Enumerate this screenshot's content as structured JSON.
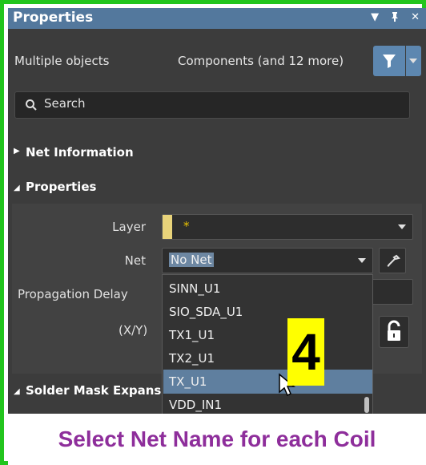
{
  "panel": {
    "title": "Properties",
    "title_icons": [
      "dropdown-arrow-icon",
      "pin-icon",
      "close-icon"
    ],
    "selection_label": "Multiple objects",
    "selection_summary": "Components (and 12 more)",
    "search_placeholder": "Search"
  },
  "sections": {
    "net_information": "Net Information",
    "properties": "Properties",
    "solder_mask": "Solder Mask Expans"
  },
  "fields": {
    "layer_label": "Layer",
    "layer_value": "*",
    "net_label": "Net",
    "net_value": "No Net",
    "propagation_label": "Propagation Delay",
    "xy_label": "(X/Y)"
  },
  "net_dropdown": {
    "items": [
      "SINN_U1",
      "SIO_SDA_U1",
      "TX1_U1",
      "TX2_U1",
      "TX_U1",
      "VDD_IN1"
    ],
    "selected": "TX_U1"
  },
  "annotation": {
    "step_number": "4",
    "caption": "Select Net Name for each Coil"
  },
  "colors": {
    "title_bar": "#53789d",
    "panel_bg": "#3c3c3c",
    "selected_item": "#5f7f9f",
    "badge": "#ffff00",
    "caption_text": "#8e2e9b",
    "frame": "#22c51d"
  }
}
